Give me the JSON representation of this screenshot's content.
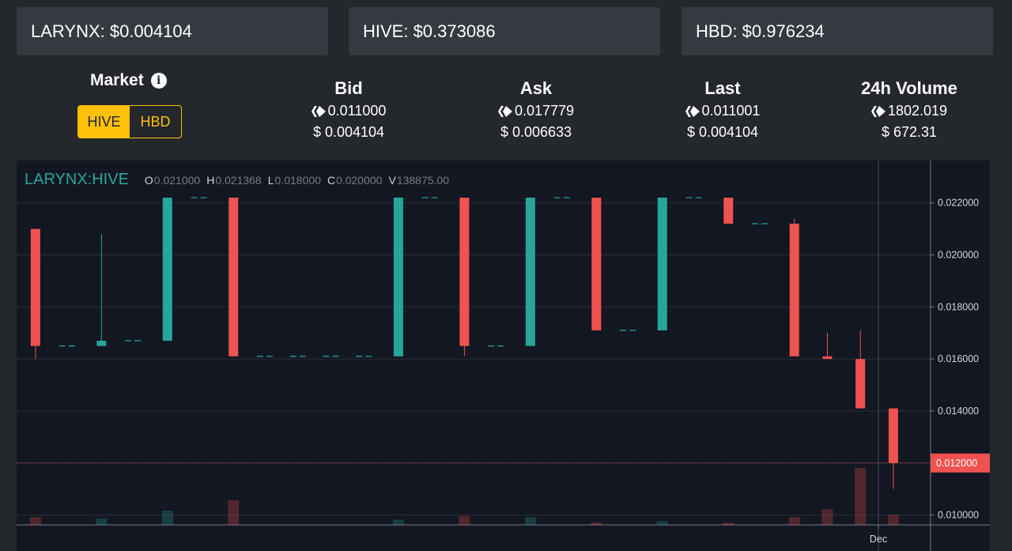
{
  "price_boxes": [
    {
      "label": "LARYNX: $0.004104"
    },
    {
      "label": "HIVE: $0.373086"
    },
    {
      "label": "HBD: $0.976234"
    }
  ],
  "market": {
    "label": "Market",
    "info_icon": "info-icon",
    "toggle": {
      "active": "HIVE",
      "inactive": "HBD"
    }
  },
  "stats": [
    {
      "title": "Bid",
      "hive": "0.011000",
      "usd": "$ 0.004104"
    },
    {
      "title": "Ask",
      "hive": "0.017779",
      "usd": "$ 0.006633"
    },
    {
      "title": "Last",
      "hive": "0.011001",
      "usd": "$ 0.004104"
    },
    {
      "title": "24h Volume",
      "hive": "1802.019",
      "usd": "$ 672.31"
    }
  ],
  "colors": {
    "up": "#26a69a",
    "down": "#ef5350",
    "accent": "#ffc107",
    "chart_bg": "#131722"
  },
  "chart_data": {
    "type": "candlestick",
    "pair": "LARYNX:HIVE",
    "ohlcv": {
      "O": "0.021000",
      "H": "0.021368",
      "L": "0.018000",
      "C": "0.020000",
      "V": "138875.00"
    },
    "y_ticks": [
      "0.022000",
      "0.020000",
      "0.018000",
      "0.016000",
      "0.014000",
      "0.012000",
      "0.010000"
    ],
    "y_tick_values": [
      0.022,
      0.02,
      0.018,
      0.016,
      0.014,
      0.012,
      0.01
    ],
    "ylim": [
      0.00962,
      0.02363
    ],
    "x_tick_label": "Dec",
    "current_price_label": "0.012000",
    "current_price": 0.012,
    "grid": true,
    "candles": [
      {
        "o": 0.021,
        "h": 0.021,
        "l": 0.016,
        "c": 0.0165,
        "v": 0.3
      },
      {
        "o": 0.0165,
        "h": 0.0165,
        "l": 0.0165,
        "c": 0.0165,
        "v": 0
      },
      {
        "o": 0.0165,
        "h": 0.0208,
        "l": 0.0165,
        "c": 0.0167,
        "v": 0.25
      },
      {
        "o": 0.0167,
        "h": 0.0167,
        "l": 0.0167,
        "c": 0.0167,
        "v": 0
      },
      {
        "o": 0.0167,
        "h": 0.0222,
        "l": 0.0167,
        "c": 0.0222,
        "v": 0.55
      },
      {
        "o": 0.0222,
        "h": 0.0222,
        "l": 0.0222,
        "c": 0.0222,
        "v": 0
      },
      {
        "o": 0.0222,
        "h": 0.0222,
        "l": 0.0161,
        "c": 0.0161,
        "v": 0.95
      },
      {
        "o": 0.0161,
        "h": 0.0161,
        "l": 0.0161,
        "c": 0.0161,
        "v": 0
      },
      {
        "o": 0.0161,
        "h": 0.0161,
        "l": 0.0161,
        "c": 0.0161,
        "v": 0
      },
      {
        "o": 0.0161,
        "h": 0.0161,
        "l": 0.0161,
        "c": 0.0161,
        "v": 0
      },
      {
        "o": 0.0161,
        "h": 0.0161,
        "l": 0.0161,
        "c": 0.0161,
        "v": 0
      },
      {
        "o": 0.0161,
        "h": 0.0222,
        "l": 0.0161,
        "c": 0.0222,
        "v": 0.2
      },
      {
        "o": 0.0222,
        "h": 0.0222,
        "l": 0.0222,
        "c": 0.0222,
        "v": 0
      },
      {
        "o": 0.0222,
        "h": 0.0222,
        "l": 0.0161,
        "c": 0.0165,
        "v": 0.35
      },
      {
        "o": 0.0165,
        "h": 0.0165,
        "l": 0.0165,
        "c": 0.0165,
        "v": 0
      },
      {
        "o": 0.0165,
        "h": 0.0222,
        "l": 0.0165,
        "c": 0.0222,
        "v": 0.3
      },
      {
        "o": 0.0222,
        "h": 0.0222,
        "l": 0.0222,
        "c": 0.0222,
        "v": 0
      },
      {
        "o": 0.0222,
        "h": 0.0222,
        "l": 0.0171,
        "c": 0.0171,
        "v": 0.1
      },
      {
        "o": 0.0171,
        "h": 0.0171,
        "l": 0.0171,
        "c": 0.0171,
        "v": 0
      },
      {
        "o": 0.0171,
        "h": 0.0222,
        "l": 0.0171,
        "c": 0.0222,
        "v": 0.15
      },
      {
        "o": 0.0222,
        "h": 0.0222,
        "l": 0.0222,
        "c": 0.0222,
        "v": 0
      },
      {
        "o": 0.0222,
        "h": 0.0222,
        "l": 0.0212,
        "c": 0.0212,
        "v": 0.05
      },
      {
        "o": 0.0212,
        "h": 0.0212,
        "l": 0.0212,
        "c": 0.0212,
        "v": 0
      },
      {
        "o": 0.0212,
        "h": 0.0214,
        "l": 0.0161,
        "c": 0.0161,
        "v": 0.3
      },
      {
        "o": 0.0161,
        "h": 0.017,
        "l": 0.016,
        "c": 0.016,
        "v": 0.6
      },
      {
        "o": 0.016,
        "h": 0.0171,
        "l": 0.0141,
        "c": 0.0141,
        "v": 2.2
      },
      {
        "o": 0.0141,
        "h": 0.0141,
        "l": 0.011,
        "c": 0.012,
        "v": 0.4
      }
    ]
  }
}
